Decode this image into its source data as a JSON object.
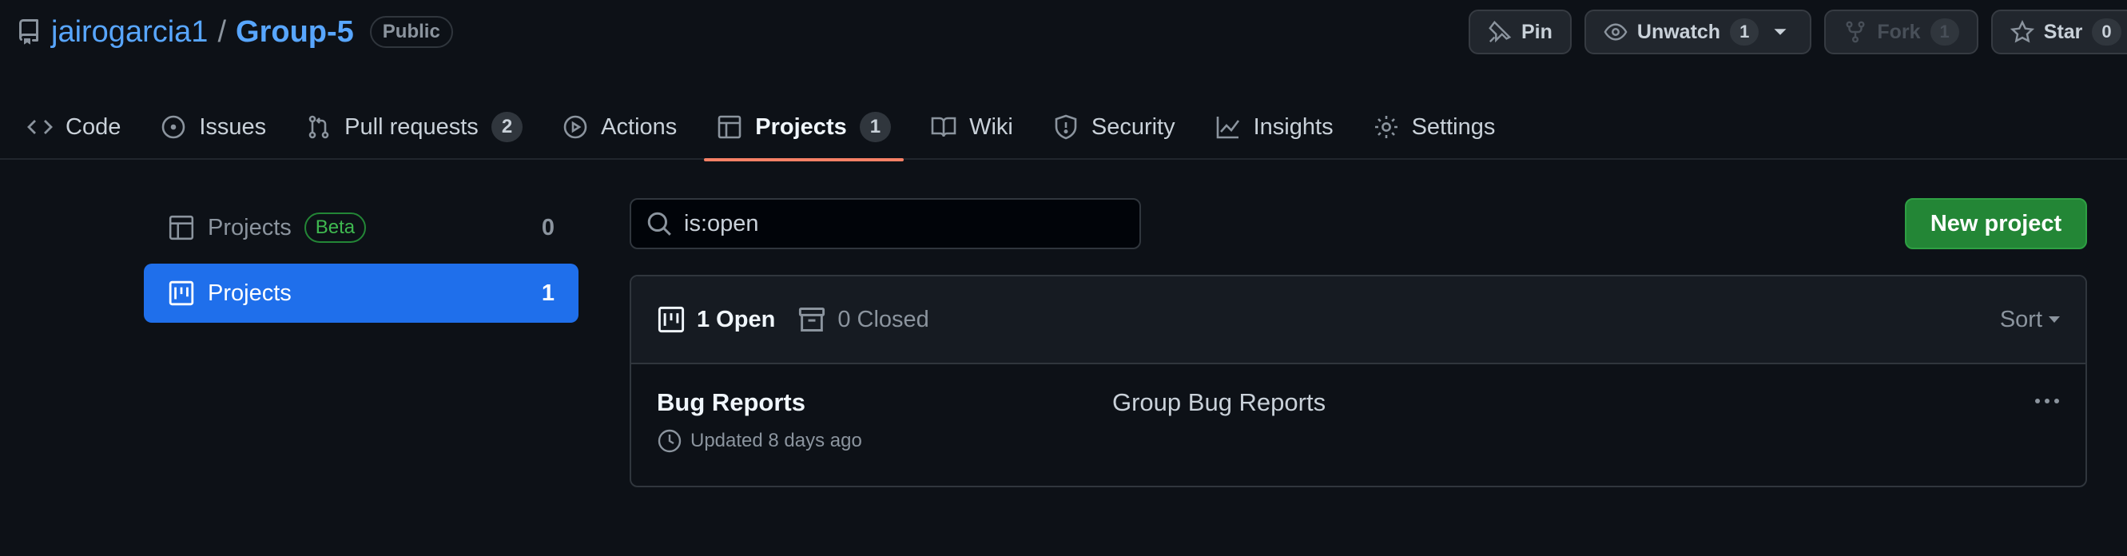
{
  "repo": {
    "owner": "jairogarcia1",
    "separator": "/",
    "name": "Group-5",
    "visibility": "Public"
  },
  "actions": {
    "pin": "Pin",
    "unwatch": "Unwatch",
    "watch_count": "1",
    "fork": "Fork",
    "fork_count": "1",
    "star": "Star",
    "star_count": "0"
  },
  "nav": {
    "code": "Code",
    "issues": "Issues",
    "pulls": "Pull requests",
    "pulls_count": "2",
    "actions": "Actions",
    "projects": "Projects",
    "projects_count": "1",
    "wiki": "Wiki",
    "security": "Security",
    "insights": "Insights",
    "settings": "Settings"
  },
  "sidebar": {
    "items": [
      {
        "label": "Projects",
        "badge": "Beta",
        "count": "0"
      },
      {
        "label": "Projects",
        "count": "1"
      }
    ]
  },
  "search": {
    "value": "is:open"
  },
  "new_project": "New project",
  "list": {
    "open_label": "1 Open",
    "closed_label": "0 Closed",
    "sort": "Sort",
    "projects": [
      {
        "name": "Bug Reports",
        "updated": "Updated 8 days ago",
        "description": "Group Bug Reports"
      }
    ]
  }
}
